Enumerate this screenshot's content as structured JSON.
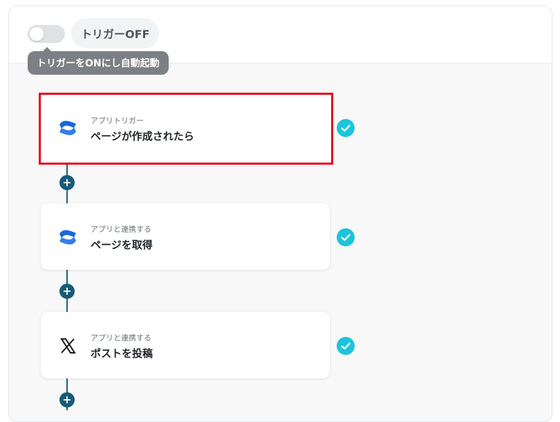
{
  "header": {
    "trigger_status": "トリガーOFF",
    "tooltip": "トリガーをONにし自動起動",
    "toggle_on": false
  },
  "steps": [
    {
      "subtitle": "アプリトリガー",
      "title": "ページが作成されたら",
      "app_icon": "confluence-icon",
      "selected": true,
      "completed": true
    },
    {
      "subtitle": "アプリと連携する",
      "title": "ページを取得",
      "app_icon": "confluence-icon",
      "selected": false,
      "completed": true
    },
    {
      "subtitle": "アプリと連携する",
      "title": "ポストを投稿",
      "app_icon": "x-logo-icon",
      "selected": false,
      "completed": true
    }
  ],
  "add_step_symbol": "+",
  "colors": {
    "selection_border": "#e60012",
    "check_circle": "#1bc4dc",
    "connector": "#1d5f7a",
    "confluence_blue": "#1868db"
  }
}
